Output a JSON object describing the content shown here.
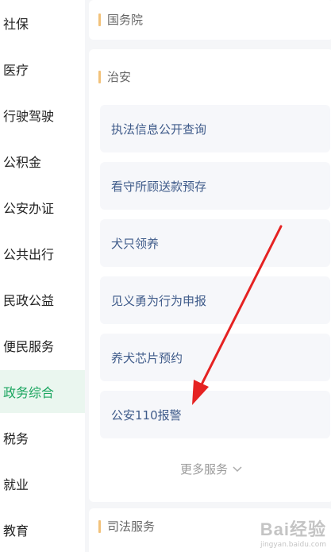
{
  "sidebar": {
    "active_index": 8,
    "items": [
      {
        "label": "社保"
      },
      {
        "label": "医疗"
      },
      {
        "label": "行驶驾驶"
      },
      {
        "label": "公积金"
      },
      {
        "label": "公安办证"
      },
      {
        "label": "公共出行"
      },
      {
        "label": "民政公益"
      },
      {
        "label": "便民服务"
      },
      {
        "label": "政务综合"
      },
      {
        "label": "税务"
      },
      {
        "label": "就业"
      },
      {
        "label": "教育"
      }
    ]
  },
  "sections": {
    "top": {
      "title": "国务院"
    },
    "security": {
      "title": "治安",
      "services": [
        {
          "label": "执法信息公开查询"
        },
        {
          "label": "看守所顾送款预存"
        },
        {
          "label": "犬只领养"
        },
        {
          "label": "见义勇为行为申报"
        },
        {
          "label": "养犬芯片预约"
        },
        {
          "label": "公安110报警"
        }
      ],
      "more_label": "更多服务"
    },
    "judicial": {
      "title": "司法服务"
    }
  },
  "colors": {
    "active_text": "#1aa55f",
    "active_bg": "#eaf6ef",
    "accent_bar": "#f2c27a",
    "service_text": "#3f5b8a",
    "arrow": "#e52222"
  },
  "watermark": {
    "logo": "Bai经验",
    "sub": "jingyan.baidu.com"
  }
}
